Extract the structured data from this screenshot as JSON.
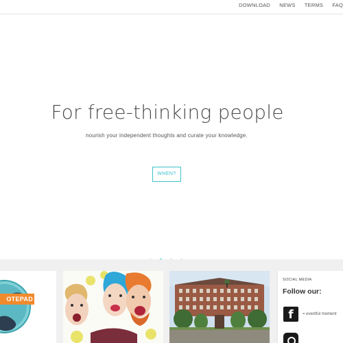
{
  "nav": {
    "items": [
      {
        "label": "DOWNLOAD"
      },
      {
        "label": "NEWS"
      },
      {
        "label": "TERMS"
      },
      {
        "label": "FAQ"
      }
    ]
  },
  "hero": {
    "title": "For free-thinking people",
    "subtitle": "nourish your independent thoughts and curate your knowledge.",
    "button_label": "WHEN?",
    "slides_total": 4,
    "active_slide": 2
  },
  "cards": {
    "notepad_label": "OTEPAD",
    "social": {
      "heading": "SOCIAL MEDIA",
      "follow": "Follow our:",
      "facebook_text": "= eventful moment",
      "facebook_glyph": "f"
    }
  },
  "colors": {
    "accent": "#3ec1c9",
    "notepad_orange": "#f08a2c",
    "lower_background": "#f0f0f0"
  },
  "icons": [
    "facebook-icon",
    "instagram-icon"
  ]
}
